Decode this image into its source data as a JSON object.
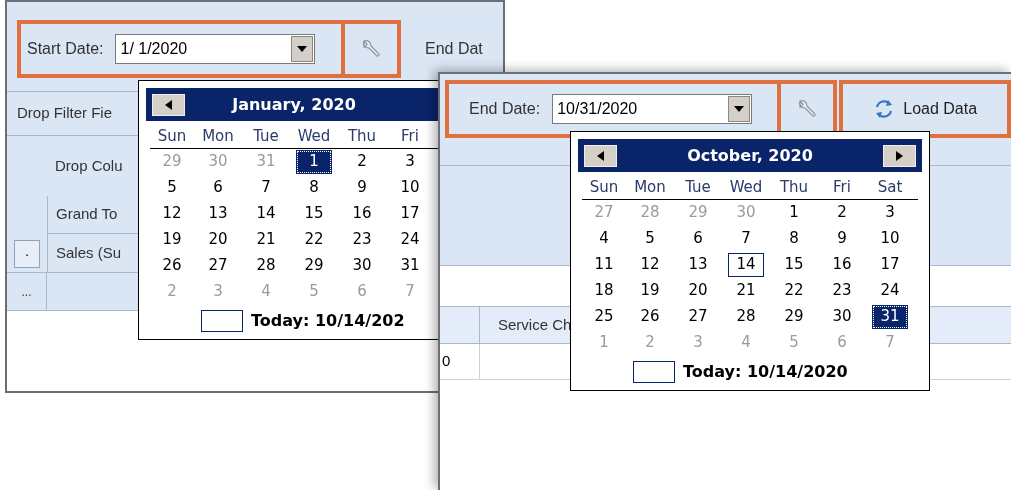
{
  "back_window": {
    "toolbar": {
      "start_date_label": "Start Date:",
      "start_date_value": "1/ 1/2020",
      "end_date_label": "End Dat"
    },
    "drop_filter_label": "Drop Filter Fie",
    "drop_column_label": "Drop Colu",
    "grid": {
      "header": "Grand To",
      "row_button": "·",
      "row_label": "Sales (Su",
      "more": "..."
    },
    "calendar": {
      "title": "January, 2020",
      "weekdays": [
        "Sun",
        "Mon",
        "Tue",
        "Wed",
        "Thu",
        "Fri"
      ],
      "weeks": [
        [
          {
            "day": "29",
            "other_month": true,
            "selected": false,
            "today": false
          },
          {
            "day": "30",
            "other_month": true,
            "selected": false,
            "today": false
          },
          {
            "day": "31",
            "other_month": true,
            "selected": false,
            "today": false
          },
          {
            "day": "1",
            "other_month": false,
            "selected": true,
            "today": false
          },
          {
            "day": "2",
            "other_month": false,
            "selected": false,
            "today": false
          },
          {
            "day": "3",
            "other_month": false,
            "selected": false,
            "today": false
          }
        ],
        [
          {
            "day": "5",
            "other_month": false,
            "selected": false,
            "today": false
          },
          {
            "day": "6",
            "other_month": false,
            "selected": false,
            "today": false
          },
          {
            "day": "7",
            "other_month": false,
            "selected": false,
            "today": false
          },
          {
            "day": "8",
            "other_month": false,
            "selected": false,
            "today": false
          },
          {
            "day": "9",
            "other_month": false,
            "selected": false,
            "today": false
          },
          {
            "day": "10",
            "other_month": false,
            "selected": false,
            "today": false
          }
        ],
        [
          {
            "day": "12",
            "other_month": false,
            "selected": false,
            "today": false
          },
          {
            "day": "13",
            "other_month": false,
            "selected": false,
            "today": false
          },
          {
            "day": "14",
            "other_month": false,
            "selected": false,
            "today": false
          },
          {
            "day": "15",
            "other_month": false,
            "selected": false,
            "today": false
          },
          {
            "day": "16",
            "other_month": false,
            "selected": false,
            "today": false
          },
          {
            "day": "17",
            "other_month": false,
            "selected": false,
            "today": false
          }
        ],
        [
          {
            "day": "19",
            "other_month": false,
            "selected": false,
            "today": false
          },
          {
            "day": "20",
            "other_month": false,
            "selected": false,
            "today": false
          },
          {
            "day": "21",
            "other_month": false,
            "selected": false,
            "today": false
          },
          {
            "day": "22",
            "other_month": false,
            "selected": false,
            "today": false
          },
          {
            "day": "23",
            "other_month": false,
            "selected": false,
            "today": false
          },
          {
            "day": "24",
            "other_month": false,
            "selected": false,
            "today": false
          }
        ],
        [
          {
            "day": "26",
            "other_month": false,
            "selected": false,
            "today": false
          },
          {
            "day": "27",
            "other_month": false,
            "selected": false,
            "today": false
          },
          {
            "day": "28",
            "other_month": false,
            "selected": false,
            "today": false
          },
          {
            "day": "29",
            "other_month": false,
            "selected": false,
            "today": false
          },
          {
            "day": "30",
            "other_month": false,
            "selected": false,
            "today": false
          },
          {
            "day": "31",
            "other_month": false,
            "selected": false,
            "today": false
          }
        ],
        [
          {
            "day": "2",
            "other_month": true,
            "selected": false,
            "today": false
          },
          {
            "day": "3",
            "other_month": true,
            "selected": false,
            "today": false
          },
          {
            "day": "4",
            "other_month": true,
            "selected": false,
            "today": false
          },
          {
            "day": "5",
            "other_month": true,
            "selected": false,
            "today": false
          },
          {
            "day": "6",
            "other_month": true,
            "selected": false,
            "today": false
          },
          {
            "day": "7",
            "other_month": true,
            "selected": false,
            "today": false
          }
        ]
      ],
      "today_text": "Today: 10/14/202"
    }
  },
  "front_window": {
    "toolbar": {
      "end_date_label": "End Date:",
      "end_date_value": "10/31/2020",
      "load_button": "Load Data"
    },
    "grid": {
      "column_header": "Service Ch",
      "cell": "0"
    },
    "calendar": {
      "title": "October, 2020",
      "weekdays": [
        "Sun",
        "Mon",
        "Tue",
        "Wed",
        "Thu",
        "Fri",
        "Sat"
      ],
      "weeks": [
        [
          {
            "day": "27",
            "other_month": true,
            "selected": false,
            "today": false
          },
          {
            "day": "28",
            "other_month": true,
            "selected": false,
            "today": false
          },
          {
            "day": "29",
            "other_month": true,
            "selected": false,
            "today": false
          },
          {
            "day": "30",
            "other_month": true,
            "selected": false,
            "today": false
          },
          {
            "day": "1",
            "other_month": false,
            "selected": false,
            "today": false
          },
          {
            "day": "2",
            "other_month": false,
            "selected": false,
            "today": false
          },
          {
            "day": "3",
            "other_month": false,
            "selected": false,
            "today": false
          }
        ],
        [
          {
            "day": "4",
            "other_month": false,
            "selected": false,
            "today": false
          },
          {
            "day": "5",
            "other_month": false,
            "selected": false,
            "today": false
          },
          {
            "day": "6",
            "other_month": false,
            "selected": false,
            "today": false
          },
          {
            "day": "7",
            "other_month": false,
            "selected": false,
            "today": false
          },
          {
            "day": "8",
            "other_month": false,
            "selected": false,
            "today": false
          },
          {
            "day": "9",
            "other_month": false,
            "selected": false,
            "today": false
          },
          {
            "day": "10",
            "other_month": false,
            "selected": false,
            "today": false
          }
        ],
        [
          {
            "day": "11",
            "other_month": false,
            "selected": false,
            "today": false
          },
          {
            "day": "12",
            "other_month": false,
            "selected": false,
            "today": false
          },
          {
            "day": "13",
            "other_month": false,
            "selected": false,
            "today": false
          },
          {
            "day": "14",
            "other_month": false,
            "selected": false,
            "today": true
          },
          {
            "day": "15",
            "other_month": false,
            "selected": false,
            "today": false
          },
          {
            "day": "16",
            "other_month": false,
            "selected": false,
            "today": false
          },
          {
            "day": "17",
            "other_month": false,
            "selected": false,
            "today": false
          }
        ],
        [
          {
            "day": "18",
            "other_month": false,
            "selected": false,
            "today": false
          },
          {
            "day": "19",
            "other_month": false,
            "selected": false,
            "today": false
          },
          {
            "day": "20",
            "other_month": false,
            "selected": false,
            "today": false
          },
          {
            "day": "21",
            "other_month": false,
            "selected": false,
            "today": false
          },
          {
            "day": "22",
            "other_month": false,
            "selected": false,
            "today": false
          },
          {
            "day": "23",
            "other_month": false,
            "selected": false,
            "today": false
          },
          {
            "day": "24",
            "other_month": false,
            "selected": false,
            "today": false
          }
        ],
        [
          {
            "day": "25",
            "other_month": false,
            "selected": false,
            "today": false
          },
          {
            "day": "26",
            "other_month": false,
            "selected": false,
            "today": false
          },
          {
            "day": "27",
            "other_month": false,
            "selected": false,
            "today": false
          },
          {
            "day": "28",
            "other_month": false,
            "selected": false,
            "today": false
          },
          {
            "day": "29",
            "other_month": false,
            "selected": false,
            "today": false
          },
          {
            "day": "30",
            "other_month": false,
            "selected": false,
            "today": false
          },
          {
            "day": "31",
            "other_month": false,
            "selected": true,
            "today": false
          }
        ],
        [
          {
            "day": "1",
            "other_month": true,
            "selected": false,
            "today": false
          },
          {
            "day": "2",
            "other_month": true,
            "selected": false,
            "today": false
          },
          {
            "day": "3",
            "other_month": true,
            "selected": false,
            "today": false
          },
          {
            "day": "4",
            "other_month": true,
            "selected": false,
            "today": false
          },
          {
            "day": "5",
            "other_month": true,
            "selected": false,
            "today": false
          },
          {
            "day": "6",
            "other_month": true,
            "selected": false,
            "today": false
          },
          {
            "day": "7",
            "other_month": true,
            "selected": false,
            "today": false
          }
        ]
      ],
      "today_text": "Today: 10/14/2020"
    }
  }
}
